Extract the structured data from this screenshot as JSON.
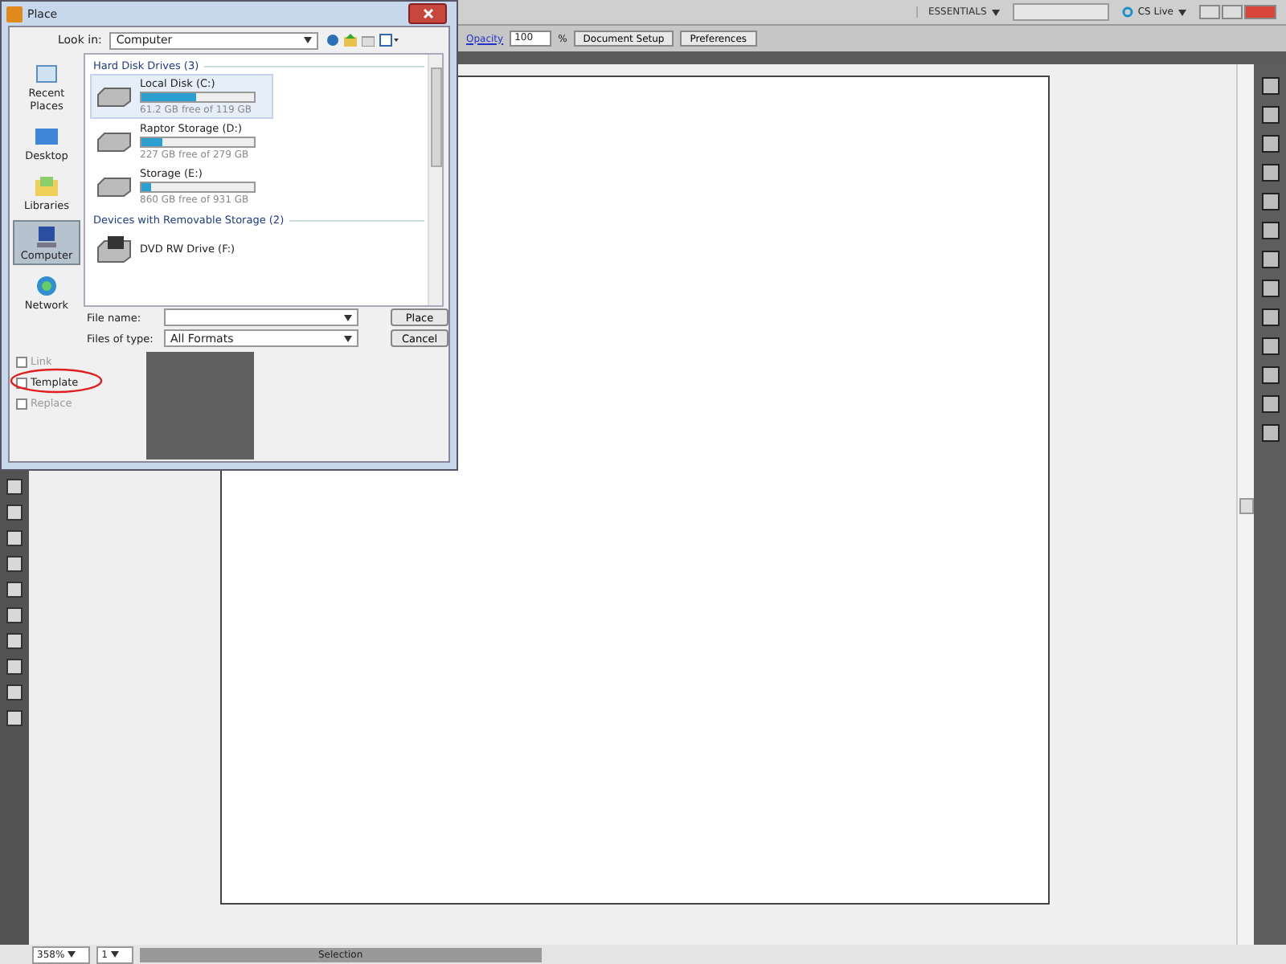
{
  "app_bar": {
    "workspace": "ESSENTIALS",
    "cs_live": "CS Live"
  },
  "control_bar": {
    "opacity_label": "Opacity",
    "opacity_value": "100",
    "percent": "%",
    "buttons": [
      "Document Setup",
      "Preferences"
    ]
  },
  "status_bar": {
    "zoom": "358%",
    "page": "1",
    "tool": "Selection"
  },
  "dialog": {
    "title": "Place",
    "look_in": {
      "label": "Look in:",
      "value": "Computer"
    },
    "places": [
      {
        "label": "Recent Places",
        "selected": false
      },
      {
        "label": "Desktop",
        "selected": false
      },
      {
        "label": "Libraries",
        "selected": false
      },
      {
        "label": "Computer",
        "selected": true
      },
      {
        "label": "Network",
        "selected": false
      }
    ],
    "groups": [
      {
        "title": "Hard Disk Drives (3)",
        "items": [
          {
            "kind": "disk",
            "name": "Local Disk (C:)",
            "level": 0.48,
            "free": "61.2 GB free of 119 GB",
            "selected": true
          },
          {
            "kind": "disk",
            "name": "Raptor Storage (D:)",
            "level": 0.19,
            "free": "227 GB free of 279 GB",
            "selected": false
          },
          {
            "kind": "disk",
            "name": "Storage (E:)",
            "level": 0.08,
            "free": "860 GB free of 931 GB",
            "selected": false
          }
        ]
      },
      {
        "title": "Devices with Removable Storage (2)",
        "items": [
          {
            "kind": "optical",
            "name": "DVD RW Drive (F:)",
            "selected": false
          }
        ]
      }
    ],
    "file_name": {
      "label": "File name:"
    },
    "file_type": {
      "label": "Files of type:",
      "value": "All Formats"
    },
    "buttons": [
      "Place",
      "Cancel"
    ],
    "options": [
      {
        "label": "Link",
        "checked": false,
        "disabled": true
      },
      {
        "label": "Template",
        "checked": false,
        "disabled": false
      },
      {
        "label": "Replace",
        "checked": false,
        "disabled": true
      }
    ]
  }
}
